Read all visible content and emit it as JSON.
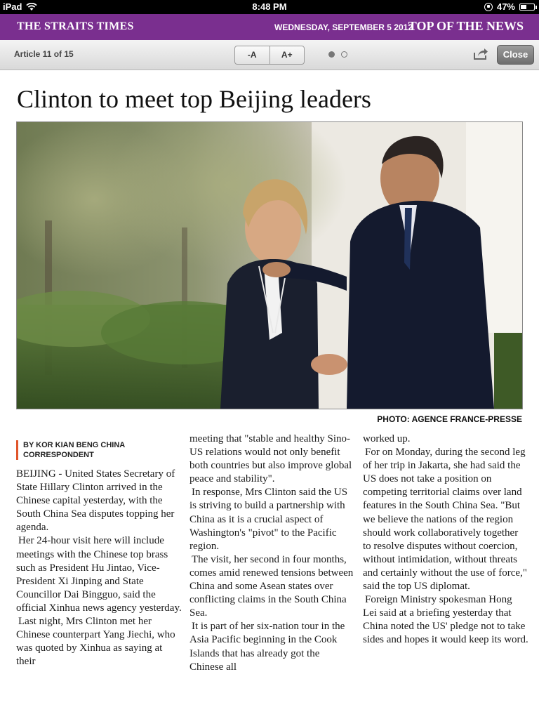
{
  "status_bar": {
    "device": "iPad",
    "time": "8:48 PM",
    "battery": "47%",
    "battery_level": 0.47
  },
  "masthead": {
    "brand": "THE STRAITS TIMES",
    "date": "WEDNESDAY, SEPTEMBER 5 2012",
    "section": "TOP OF THE NEWS",
    "color": "#7a2f8f"
  },
  "toolbar": {
    "article_count": "Article 11 of 15",
    "font_decrease": "-A",
    "font_increase": "A+",
    "close": "Close",
    "page_dots": {
      "total": 2,
      "current": 1
    },
    "share_icon": "share-icon"
  },
  "article": {
    "headline": "Clinton to meet top Beijing leaders",
    "photo_credit": "PHOTO: AGENCE FRANCE-PRESSE",
    "byline": "BY KOR KIAN BENG CHINA CORRESPONDENT",
    "byline_accent": "#e0552b",
    "col1": [
      "BEIJING - United States Secretary of State Hillary Clinton arrived in the Chinese capital yesterday, with the South China Sea disputes topping her agenda.",
      "Her 24-hour visit here will include meetings with the Chinese top brass such as President Hu Jintao, Vice-President Xi Jinping and State Councillor Dai Bingguo, said the official Xinhua news agency yesterday.",
      "Last night, Mrs Clinton met her Chinese counterpart Yang Jiechi, who was quoted by Xinhua as saying at their"
    ],
    "col2": [
      "meeting that \"stable and healthy Sino-US relations would not only benefit both countries but also improve global peace and stability\".",
      "In response, Mrs Clinton said the US is striving to build a partnership with China as it is a crucial aspect of Washington's \"pivot\" to the Pacific region.",
      "The visit, her second in four months, comes amid renewed tensions between China and some Asean states over conflicting claims in the South China Sea.",
      "It is part of her six-nation tour in the Asia Pacific beginning in the Cook Islands that has already got the Chinese all"
    ],
    "col3": [
      "worked up.",
      "For on Monday, during the second leg of her trip in Jakarta, she had said the US does not take a position on competing territorial claims over land features in the South China Sea. \"But we believe the nations of the region should work collaboratively together to resolve disputes without coercion, without intimidation, without threats and certainly without the use of force,\" said the top US diplomat.",
      "Foreign Ministry spokesman Hong Lei said at a briefing yesterday that China noted the US' pledge not to take sides and hopes it would keep its word."
    ]
  }
}
